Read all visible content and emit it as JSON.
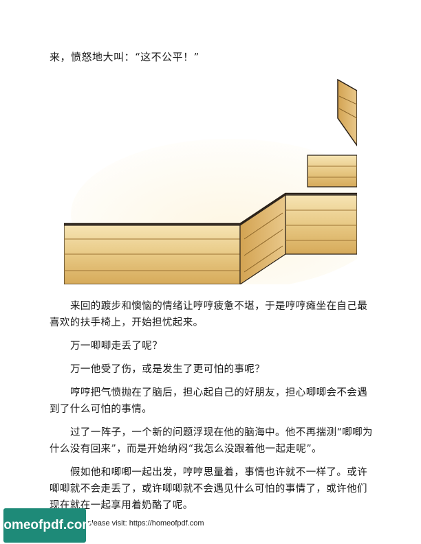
{
  "top_line": "来，愤怒地大叫：“这不公平！”",
  "paragraphs": [
    "来回的踱步和懊恼的情绪让哼哼疲惫不堪，于是哼哼瘫坐在自己最喜欢的扶手椅上，开始担忧起来。",
    "万一唧唧走丢了呢？",
    "万一他受了伤，或是发生了更可怕的事呢？",
    "哼哼把气愤抛在了脑后，担心起自己的好朋友，担心唧唧会不会遇到了什么可怕的事情。",
    "过了一阵子，一个新的问题浮现在他的脑海中。他不再揣测“唧唧为什么没有回来”，而是开始纳闷“我怎么没跟着他一起走呢”。",
    "假如他和唧唧一起出发，哼哼思量着，事情也许就不一样了。或许唧唧就不会走丢了，或许唧唧就不会遇见什么可怕的事情了，或许他们现在就在一起享用着奶酪了呢。"
  ],
  "footer": {
    "logo_text": "homeofpdf.com",
    "visit_text": "e please visit: https://homeofpdf.com"
  },
  "illustration": {
    "subject": "maze-walls",
    "colors": {
      "wood_light": "#f3dca2",
      "wood_mid": "#e2bd72",
      "wood_dark": "#c9963f",
      "outline": "#2a2118"
    }
  }
}
